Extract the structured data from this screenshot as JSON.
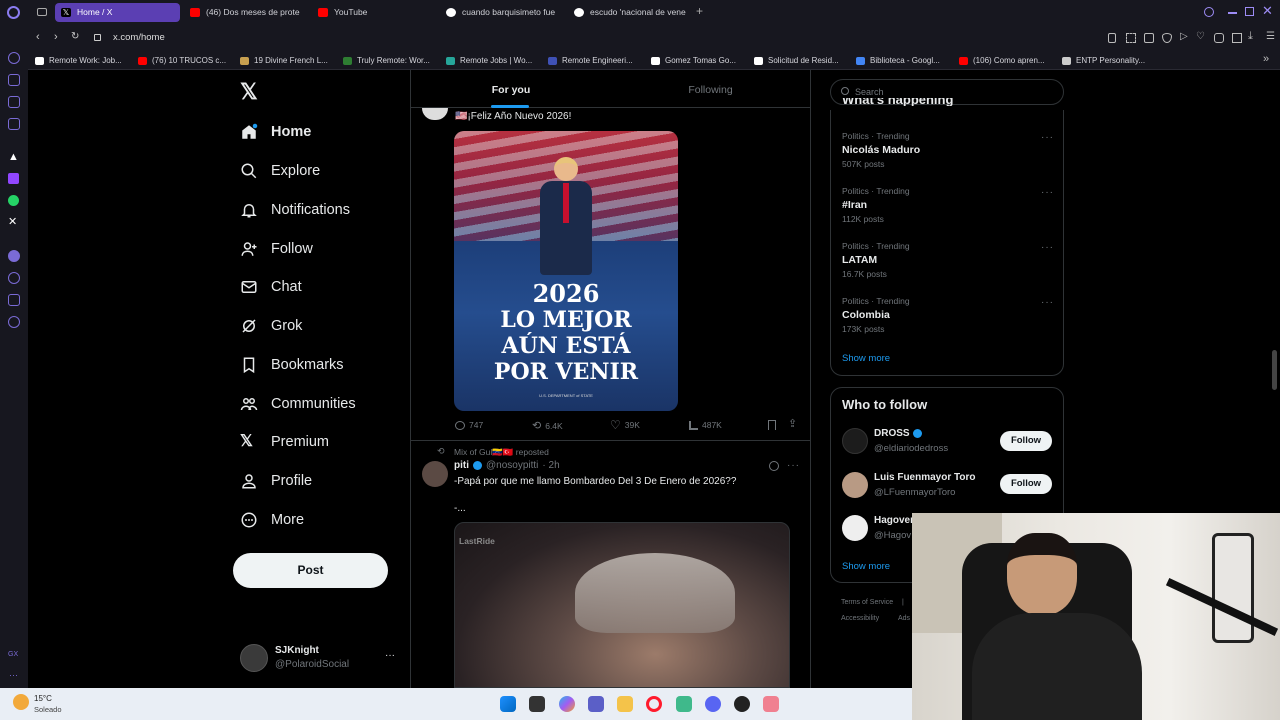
{
  "browser": {
    "tabs": [
      {
        "label": "Home / X",
        "fav_color": "#000000",
        "active": true
      },
      {
        "label": "(46) Dos meses de prote",
        "fav_color": "#ff0000"
      },
      {
        "label": "YouTube",
        "fav_color": "#ff0000"
      },
      {
        "label": "cuando barquisimeto fue",
        "fav_color": "#ffffff"
      },
      {
        "label": "escudo 'nacional de vene",
        "fav_color": "#ffffff"
      }
    ],
    "new_tab_label": "+",
    "url": "x.com/home",
    "bookmarks": [
      {
        "label": "Remote Work: Job...",
        "fav_color": "#ffffff"
      },
      {
        "label": "(76) 10 TRUCOS c...",
        "fav_color": "#ff0000"
      },
      {
        "label": "19 Divine French L...",
        "fav_color": "#c8a050"
      },
      {
        "label": "Truly Remote: Wor...",
        "fav_color": "#2e7d32"
      },
      {
        "label": "Remote Jobs | Wo...",
        "fav_color": "#26a69a"
      },
      {
        "label": "Remote Engineeri...",
        "fav_color": "#3f51b5"
      },
      {
        "label": "Gomez Tomas Go...",
        "fav_color": "#ffffff"
      },
      {
        "label": "Solicitud de Resid...",
        "fav_color": "#ffffff"
      },
      {
        "label": "Biblioteca - Googl...",
        "fav_color": "#4285f4"
      },
      {
        "label": "(106) Como apren...",
        "fav_color": "#ff0000"
      },
      {
        "label": "ENTP Personality...",
        "fav_color": "#cccccc"
      }
    ]
  },
  "x": {
    "logo_icon": "x-logo-icon",
    "nav": [
      {
        "label": "Home",
        "icon": "home-icon"
      },
      {
        "label": "Explore",
        "icon": "search-icon"
      },
      {
        "label": "Notifications",
        "icon": "bell-icon"
      },
      {
        "label": "Follow",
        "icon": "add-user-icon"
      },
      {
        "label": "Chat",
        "icon": "mail-icon"
      },
      {
        "label": "Grok",
        "icon": "grok-icon"
      },
      {
        "label": "Bookmarks",
        "icon": "bookmark-icon"
      },
      {
        "label": "Communities",
        "icon": "communities-icon"
      },
      {
        "label": "Premium",
        "icon": "x-logo-icon"
      },
      {
        "label": "Profile",
        "icon": "person-icon"
      },
      {
        "label": "More",
        "icon": "more-circle-icon"
      }
    ],
    "post_button": "Post",
    "account": {
      "name": "SJKnight",
      "handle": "@PolaroidSocial",
      "more": "···"
    },
    "feed_tabs": [
      {
        "label": "For you"
      },
      {
        "label": "Following"
      }
    ],
    "post1": {
      "text": "🇺🇸¡Feliz Año Nuevo 2026!",
      "image_lines": [
        "2026",
        "LO MEJOR",
        "AÚN ESTÁ",
        "POR VENIR"
      ],
      "image_caption": "U.S. DEPARTMENT of STATE",
      "replies": "747",
      "reposts": "6.4K",
      "likes": "39K",
      "views": "487K"
    },
    "post2": {
      "reposted_by": "Mix of Gul🇻🇪🇹🇷 reposted",
      "name": "piti",
      "handle": "@nosoypitti",
      "time": "· 2h",
      "text": "-Papá por que me llamo Bombardeo Del 3 De Enero de 2026??",
      "text2": "-...",
      "video_watermark": "LastRide"
    },
    "search_placeholder": "Search",
    "whats_happening_title": "What's happening",
    "trends": [
      {
        "meta": "Politics · Trending",
        "title": "Nicolás Maduro",
        "count": "507K posts"
      },
      {
        "meta": "Politics · Trending",
        "title": "#Iran",
        "count": "112K posts"
      },
      {
        "meta": "Politics · Trending",
        "title": "LATAM",
        "count": "16.7K posts"
      },
      {
        "meta": "Politics · Trending",
        "title": "Colombia",
        "count": "173K posts"
      }
    ],
    "show_more": "Show more",
    "who_to_follow_title": "Who to follow",
    "suggestions": [
      {
        "name": "DROSS",
        "handle": "@eldiariodedross",
        "verified": true,
        "button": "Follow"
      },
      {
        "name": "Luis Fuenmayor Toro",
        "handle": "@LFuenmayorToro",
        "verified": false,
        "button": "Follow"
      },
      {
        "name": "Hagover",
        "handle": "@Hagov",
        "verified": false
      }
    ],
    "show_more2": "Show more",
    "footer": {
      "terms": "Terms of Service",
      "sep": "|",
      "accessibility": "Accessibility",
      "ads": "Ads"
    }
  },
  "taskbar": {
    "weather_temp": "15°C",
    "weather_desc": "Soleado"
  }
}
